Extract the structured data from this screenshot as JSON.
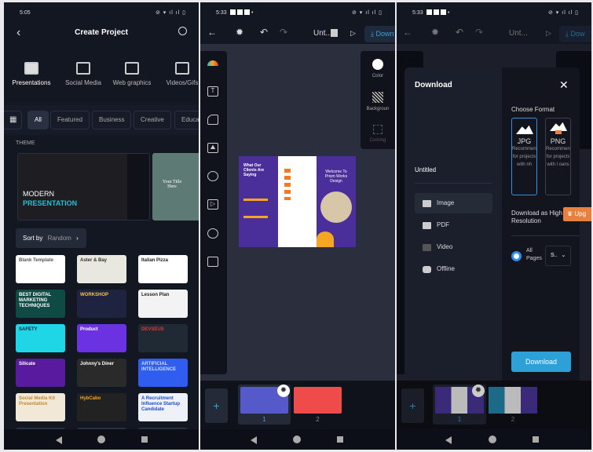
{
  "screen1": {
    "status_time": "5:05",
    "status_icons": "⊘ ▾ ıl ıl ▯",
    "title": "Create Project",
    "categories": [
      "Presentations",
      "Social Media",
      "Web graphics",
      "Videos/Gifs"
    ],
    "chips": [
      "All",
      "Featured",
      "Business",
      "Creative",
      "Educati"
    ],
    "theme_label": "THEME",
    "theme_cards": [
      {
        "line1": "MODERN",
        "line2": "PRESENTATION"
      },
      {
        "line1": "Your Title Here"
      }
    ],
    "sort_label": "Sort by",
    "sort_value": "Random",
    "templates": [
      "Blank Template",
      "Aster & Bay",
      "Italian Pizza",
      "BEST DIGITAL MARKETING TECHNIQUES",
      "WORKSHOP",
      "Lesson Plan",
      "SAFETY",
      "Product",
      "DEVSEUS",
      "Silicate",
      "Johnny's Diner",
      "ARTIFICIAL INTELLIGENCE",
      "Social Media Kit Presentation",
      "HybCabo",
      "A Recruitment Influence Startup Candidate"
    ]
  },
  "screen2": {
    "status_time": "5:33",
    "status_icons": "⊘ ▾ ıl ıl ▯",
    "doc_title": "Unt...",
    "download_label": "Down",
    "right_tools": [
      "Color",
      "Backgroun",
      "Coming"
    ],
    "design": {
      "left_title": "What Our Clients Are Saying",
      "right_title": "Welcome To Prism Works Design"
    },
    "pages": [
      "1",
      "2"
    ],
    "page_colors": [
      "#5559c9",
      "#f04b4b"
    ]
  },
  "screen3": {
    "status_time": "5:33",
    "status_icons": "⊘ ▾ ıl ıl ▯",
    "doc_title": "Unt...",
    "download_label": "Dow",
    "modal": {
      "title": "Download",
      "file_name": "Untitled",
      "types": [
        "Image",
        "PDF",
        "Video",
        "Offline"
      ],
      "choose_format": "Choose Format",
      "formats": [
        {
          "name": "JPG",
          "desc": "Recommended for projects with nh"
        },
        {
          "name": "PNG",
          "desc": "Recommended for projects with l oans"
        }
      ],
      "high_res": "Download as High Resolution",
      "upgrade": "Upg",
      "all_pages": "All Pages",
      "select_value": "S..",
      "download_button": "Download"
    },
    "pages": [
      "1",
      "2"
    ]
  },
  "colors": {
    "accent": "#2ea0d8",
    "upgrade": "#e8803f",
    "bg": "#131722"
  }
}
